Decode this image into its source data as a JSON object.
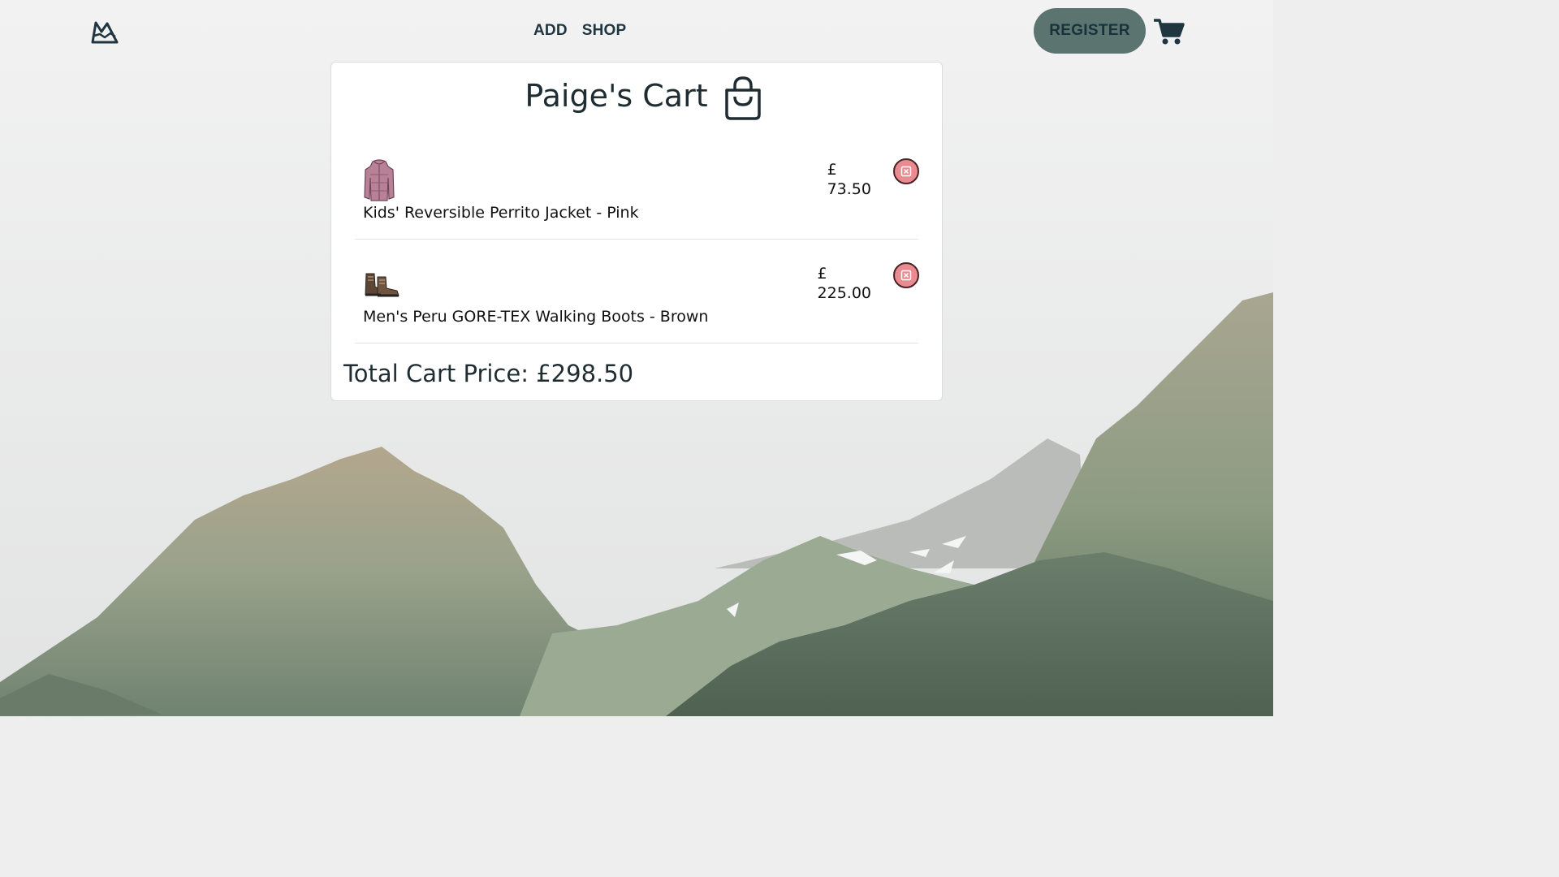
{
  "nav": {
    "logo_icon": "mountain-logo-icon",
    "links": [
      {
        "label": "ADD"
      },
      {
        "label": "SHOP"
      }
    ],
    "register_label": "REGISTER",
    "cart_icon": "shopping-cart-icon"
  },
  "cart": {
    "title": "Paige's Cart",
    "title_icon": "shopping-bag-icon",
    "items": [
      {
        "name": "Kids' Reversible Perrito Jacket - Pink",
        "currency": "£",
        "price": "73.50",
        "thumb_icon": "pink-jacket-image",
        "remove_icon": "remove-item-icon"
      },
      {
        "name": "Men's Peru GORE-TEX Walking Boots - Brown",
        "currency": "£",
        "price": "225.00",
        "thumb_icon": "brown-boots-image",
        "remove_icon": "remove-item-icon"
      }
    ],
    "total_label": "Total Cart Price: £298.50"
  },
  "colors": {
    "accent_dark": "#1f3640",
    "register_bg": "#5b7470",
    "remove_bg": "#e98b8f",
    "card_bg": "#ffffff"
  }
}
